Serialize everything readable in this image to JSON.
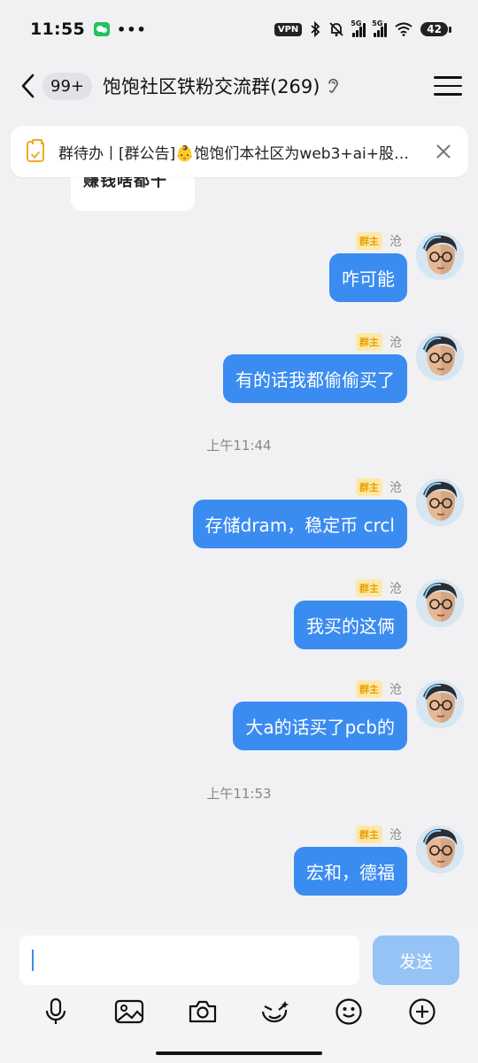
{
  "status_bar": {
    "time": "11:55",
    "dots": "•••",
    "vpn": "VPN",
    "sig1_label": "5G",
    "sig2_label": "5G",
    "battery": "42"
  },
  "header": {
    "unread_count": "99+",
    "title": "饱饱社区铁粉交流群(269)"
  },
  "notice": {
    "text": "群待办丨[群公告]👶饱饱们本社区为web3+ai+股…"
  },
  "peer_fragment": "赚钱啥都干",
  "messages": [
    {
      "badge": "群主",
      "sender": "沧",
      "text": "咋可能"
    },
    {
      "badge": "群主",
      "sender": "沧",
      "text": "有的话我都偷偷买了"
    },
    {
      "badge": "群主",
      "sender": "沧",
      "text": "存储dram，稳定币 crcl"
    },
    {
      "badge": "群主",
      "sender": "沧",
      "text": "我买的这俩"
    },
    {
      "badge": "群主",
      "sender": "沧",
      "text": "大a的话买了pcb的"
    },
    {
      "badge": "群主",
      "sender": "沧",
      "text": "宏和，德福"
    }
  ],
  "time_separators": [
    "上午11:44",
    "上午11:53"
  ],
  "input": {
    "value": "",
    "send_label": "发送"
  },
  "colors": {
    "bubble_blue": "#3b8cf0",
    "send_disabled": "#95c3f5",
    "owner_badge_bg": "#fde8a9",
    "owner_badge_text": "#e8a000",
    "notice_icon": "#f0a92c"
  }
}
